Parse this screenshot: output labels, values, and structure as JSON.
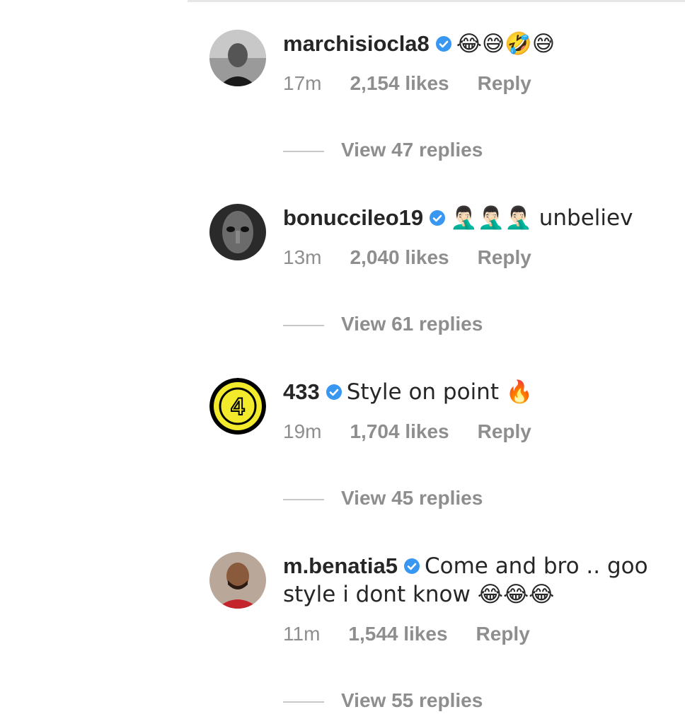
{
  "comments": [
    {
      "username": "marchisiocla8",
      "text": "😂😅🤣😅",
      "time": "17m",
      "likes": "2,154 likes",
      "reply": "Reply",
      "view_replies": "View 47 replies"
    },
    {
      "username": "bonuccileo19",
      "text": "🤦🏻‍♂️🤦🏻‍♂️🤦🏻‍♂️ unbeliev",
      "time": "13m",
      "likes": "2,040 likes",
      "reply": "Reply",
      "view_replies": "View 61 replies"
    },
    {
      "username": "433",
      "text": "Style on point 🔥",
      "time": "19m",
      "likes": "1,704 likes",
      "reply": "Reply",
      "view_replies": "View 45 replies"
    },
    {
      "username": "m.benatia5",
      "text": "Come and bro .. goo style i dont know 😂😂😂",
      "time": "11m",
      "likes": "1,544 likes",
      "reply": "Reply",
      "view_replies": "View 55 replies"
    }
  ],
  "colors": {
    "verified": "#3897f0",
    "secondary_text": "#8e8e8e",
    "primary_text": "#262626",
    "logo_433_fill": "#f2ea2a"
  },
  "icons": {
    "verified": "verified-badge-icon"
  }
}
